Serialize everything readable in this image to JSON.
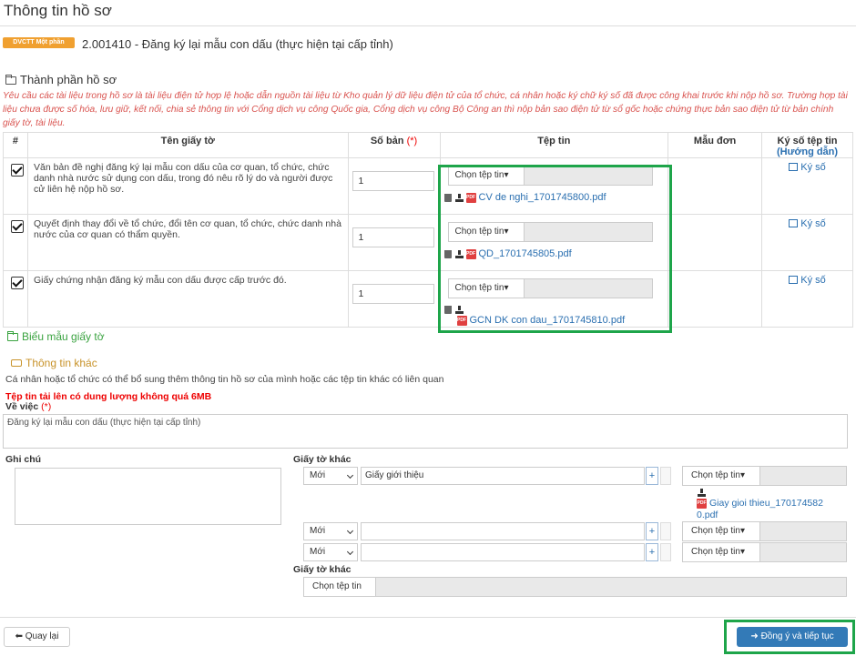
{
  "page_title": "Thông tin hồ sơ",
  "badge": "DVCTT Một phần",
  "procedure_title": "2.001410 - Đăng ký lại mẫu con dấu (thực hiện tại cấp tỉnh)",
  "section_components": "Thành phần hồ sơ",
  "warning": "Yêu cầu các tài liệu trong hồ sơ là tài liệu điện tử hợp lệ hoặc dẫn nguồn tài liệu từ Kho quản lý dữ liệu điện tử của tổ chức, cá nhân hoặc ký chữ ký số đã được công khai trước khi nộp hồ sơ. Trường hợp tài liệu chưa được số hóa, lưu giữ, kết nối, chia sẻ thông tin với Cổng dịch vụ công Quốc gia, Cổng dịch vụ công Bộ Công an thì nộp bản sao điện tử từ sổ gốc hoặc chứng thực bản sao điện tử từ bản chính giấy tờ, tài liệu.",
  "table": {
    "headers": {
      "num": "#",
      "name": "Tên giấy tờ",
      "copies": "Số bản",
      "required_mark": "(*)",
      "file": "Tệp tin",
      "template": "Mẫu đơn",
      "sign": "Ký số tệp tin",
      "sign_guide": "(Hướng dẫn)"
    },
    "rows": [
      {
        "name": "Văn bản đề nghị đăng ký lại mẫu con dấu của cơ quan, tổ chức, chức danh nhà nước sử dụng con dấu, trong đó nêu rõ lý do và người được cử liên hệ nộp hồ sơ.",
        "copies": "1",
        "choose_label": "Chọn tệp tin",
        "file_name": "CV de nghi_1701745800.pdf",
        "sign_label": "Ký số"
      },
      {
        "name": "Quyết định thay đổi về tổ chức, đổi tên cơ quan, tổ chức, chức danh nhà nước của cơ quan có thẩm quyền.",
        "copies": "1",
        "choose_label": "Chọn tệp tin",
        "file_name": "QD_1701745805.pdf",
        "sign_label": "Ký số"
      },
      {
        "name": "Giấy chứng nhận đăng ký mẫu con dấu được cấp trước đó.",
        "copies": "1",
        "choose_label": "Chọn tệp tin",
        "file_name": "GCN DK con dau_1701745810.pdf",
        "sign_label": "Ký số"
      }
    ]
  },
  "section_forms": "Biểu mẫu giấy tờ",
  "section_other": "Thông tin khác",
  "other_note": "Cá nhân hoặc tổ chức có thể bổ sung thêm thông tin hồ sơ của mình hoặc các tệp tin khác có liên quan",
  "size_note": "Tệp tin tải lên có dung lượng không quá 6MB",
  "subject_label": "Về việc",
  "subject_required": "(*)",
  "subject_value": "Đăng ký lại mẫu con dấu (thực hiện tại cấp tỉnh)",
  "note_label": "Ghi chú",
  "other_docs_label": "Giấy tờ khác",
  "other_docs": [
    {
      "type": "Mới",
      "name": "Giấy giới thiệu",
      "plus": "+",
      "choose_label": "Chọn tệp tin",
      "file_line1": "Giay gioi thieu_170174582",
      "file_line2": "0.pdf"
    },
    {
      "type": "Mới",
      "name": "",
      "plus": "+",
      "choose_label": "Chọn tệp tin"
    },
    {
      "type": "Mới",
      "name": "",
      "plus": "+",
      "choose_label": "Chọn tệp tin"
    }
  ],
  "other_docs_label2": "Giấy tờ khác",
  "other_docs_choose": "Chọn tệp tin",
  "back_button": "Quay lại",
  "next_button": "Đồng ý và tiếp tục"
}
